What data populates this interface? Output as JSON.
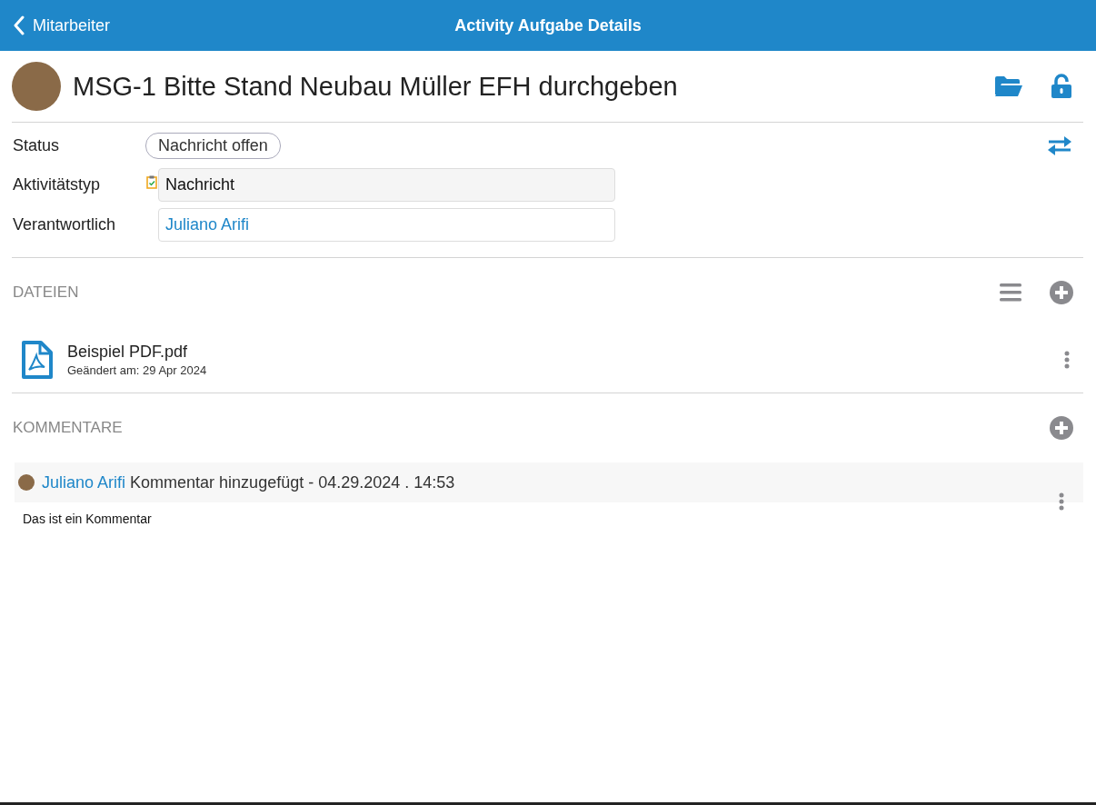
{
  "nav_bar": {
    "back_label": "Mitarbeiter",
    "title": "Activity Aufgabe Details"
  },
  "header": {
    "title": "MSG-1 Bitte Stand Neubau Müller EFH durchgeben"
  },
  "fields": [
    {
      "kind": "status",
      "label": "Status",
      "value": "Nachricht offen"
    },
    {
      "kind": "readonly",
      "label": "Aktivitätstyp",
      "value": "Nachricht"
    },
    {
      "kind": "link",
      "label": "Verantwortlich",
      "value": "Juliano Arifi"
    }
  ],
  "files": {
    "heading": "DATEIEN",
    "items": [
      {
        "name": "Beispiel PDF.pdf",
        "modified": "Geändert am: 29 Apr 2024"
      }
    ]
  },
  "comments": {
    "heading": "KOMMENTARE",
    "items": [
      {
        "author": "Juliano Arifi",
        "action": "Kommentar hinzugefügt - 04.29.2024 . 14:53",
        "text": "Das ist ein Kommentar"
      }
    ]
  }
}
